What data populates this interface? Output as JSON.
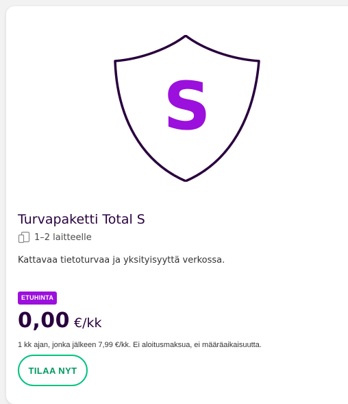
{
  "product": {
    "icon": "shield-s-icon",
    "icon_letter": "S",
    "title": "Turvapaketti Total S",
    "devices_icon": "devices-icon",
    "devices": "1–2 laitteelle",
    "description": "Kattavaa tietoturvaa ja yksityisyyttä verkossa.",
    "badge": "ETUHINTA",
    "price": "0,00",
    "price_unit": "€/kk",
    "terms": "1 kk ajan, jonka jälkeen 7,99 €/kk. Ei aloitusmaksua, ei määräaikaisuutta.",
    "order_button": "TILAA NYT"
  },
  "colors": {
    "shield_outline": "#29003e",
    "letter": "#9b10dc",
    "badge_bg": "#9b10dc",
    "button_border": "#00c37e",
    "button_text": "#00995f",
    "title_text": "#29003e"
  }
}
